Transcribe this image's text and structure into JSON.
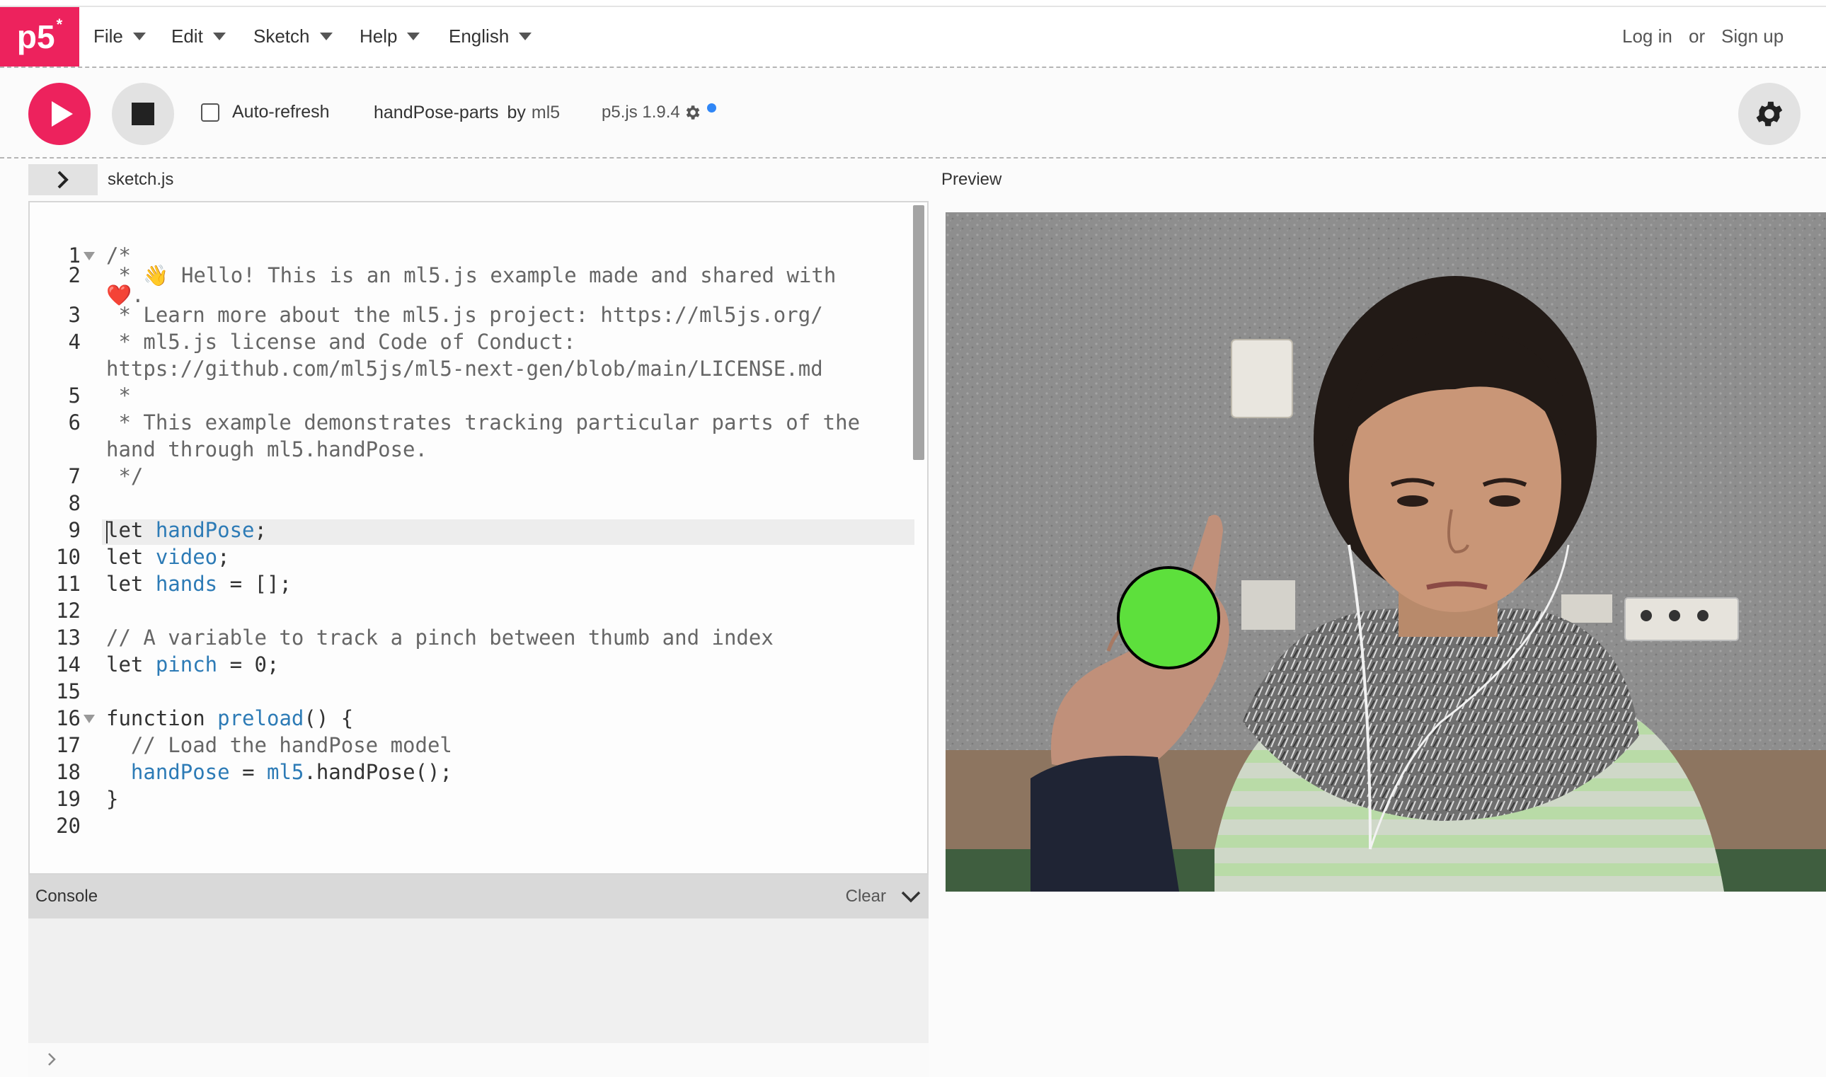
{
  "nav": {
    "logo": "p5",
    "logo_sup": "*",
    "menus": [
      "File",
      "Edit",
      "Sketch",
      "Help",
      "English"
    ],
    "login": "Log in",
    "or": "or",
    "signup": "Sign up"
  },
  "toolbar": {
    "autorefresh_label": "Auto-refresh",
    "autorefresh_checked": false,
    "sketch_name": "handPose-parts",
    "by": "by",
    "author": "ml5",
    "version": "p5.js 1.9.4"
  },
  "editor": {
    "file_name": "sketch.js",
    "lines": [
      {
        "n": "1",
        "text": "/*"
      },
      {
        "n": "2",
        "text": " * 👋 Hello! This is an ml5.js example made and shared with"
      },
      {
        "n": "",
        "text": "❤️."
      },
      {
        "n": "3",
        "text": " * Learn more about the ml5.js project: https://ml5js.org/"
      },
      {
        "n": "4",
        "text": " * ml5.js license and Code of Conduct:"
      },
      {
        "n": "",
        "text": "https://github.com/ml5js/ml5-next-gen/blob/main/LICENSE.md"
      },
      {
        "n": "5",
        "text": " *"
      },
      {
        "n": "6",
        "text": " * This example demonstrates tracking particular parts of the"
      },
      {
        "n": "",
        "text": "hand through ml5.handPose."
      },
      {
        "n": "7",
        "text": " */"
      },
      {
        "n": "8",
        "text": ""
      },
      {
        "n": "9",
        "text": "let handPose;"
      },
      {
        "n": "10",
        "text": "let video;"
      },
      {
        "n": "11",
        "text": "let hands = [];"
      },
      {
        "n": "12",
        "text": ""
      },
      {
        "n": "13",
        "text": "// A variable to track a pinch between thumb and index"
      },
      {
        "n": "14",
        "text": "let pinch = 0;"
      },
      {
        "n": "15",
        "text": ""
      },
      {
        "n": "16",
        "text": "function preload() {"
      },
      {
        "n": "17",
        "text": "  // Load the handPose model"
      },
      {
        "n": "18",
        "text": "  handPose = ml5.handPose();"
      },
      {
        "n": "19",
        "text": "}"
      },
      {
        "n": "20",
        "text": ""
      }
    ]
  },
  "console": {
    "title": "Console",
    "clear": "Clear"
  },
  "preview": {
    "label": "Preview",
    "indicator_color": "#5de03c"
  },
  "colors": {
    "accent": "#ed225d",
    "keyword_var": "#2d7bb6",
    "version_dot": "#2f86f6"
  }
}
